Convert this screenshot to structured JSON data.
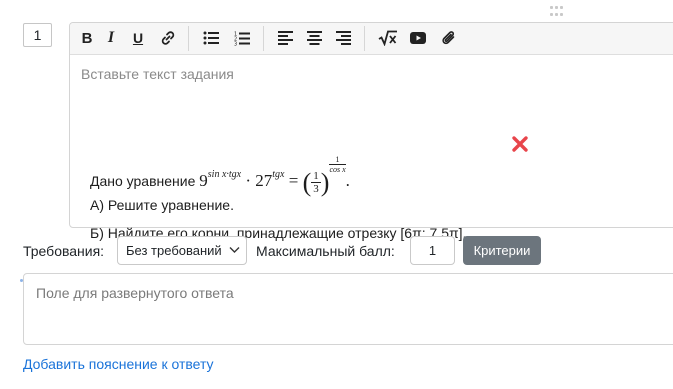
{
  "task": {
    "number": "1"
  },
  "editor": {
    "toolbar": {
      "bold": "B",
      "italic": "I",
      "underline": "U",
      "formula": "√x"
    },
    "placeholder": "Вставьте текст задания",
    "content": {
      "equation_prefix": "Дано уравнение",
      "line_a": "А) Решите уравнение.",
      "line_b": "Б) Найдите его корни, принадлежащие отрезку [6π; 7,5π]."
    },
    "math": {
      "base1": "9",
      "exp1": "sin x·tgx",
      "dot": "·",
      "base2": "27",
      "exp2": "tgx",
      "equals": "=",
      "frac_num": "1",
      "frac_den": "3",
      "exp3_num": "1",
      "exp3_den": "cos x",
      "period": "."
    }
  },
  "requirements": {
    "label": "Требования:",
    "selected": "Без требований",
    "max_score_label": "Максимальный балл:",
    "max_score_value": "1",
    "criteria_button": "Критерии"
  },
  "answer": {
    "placeholder": "Поле для развернутого ответа"
  },
  "add_explanation_link": "Добавить пояснение к ответу",
  "colors": {
    "accent_link": "#1a73d9",
    "delete_red": "#e8454b",
    "criteria_button_bg": "#6c757d"
  },
  "icons": [
    "drag-handle-icon",
    "bold-icon",
    "italic-icon",
    "underline-icon",
    "link-icon",
    "bullet-list-icon",
    "numbered-list-icon",
    "align-left-icon",
    "align-center-icon",
    "align-right-icon",
    "formula-icon",
    "youtube-icon",
    "attachment-icon",
    "delete-icon",
    "chevron-down-icon"
  ]
}
